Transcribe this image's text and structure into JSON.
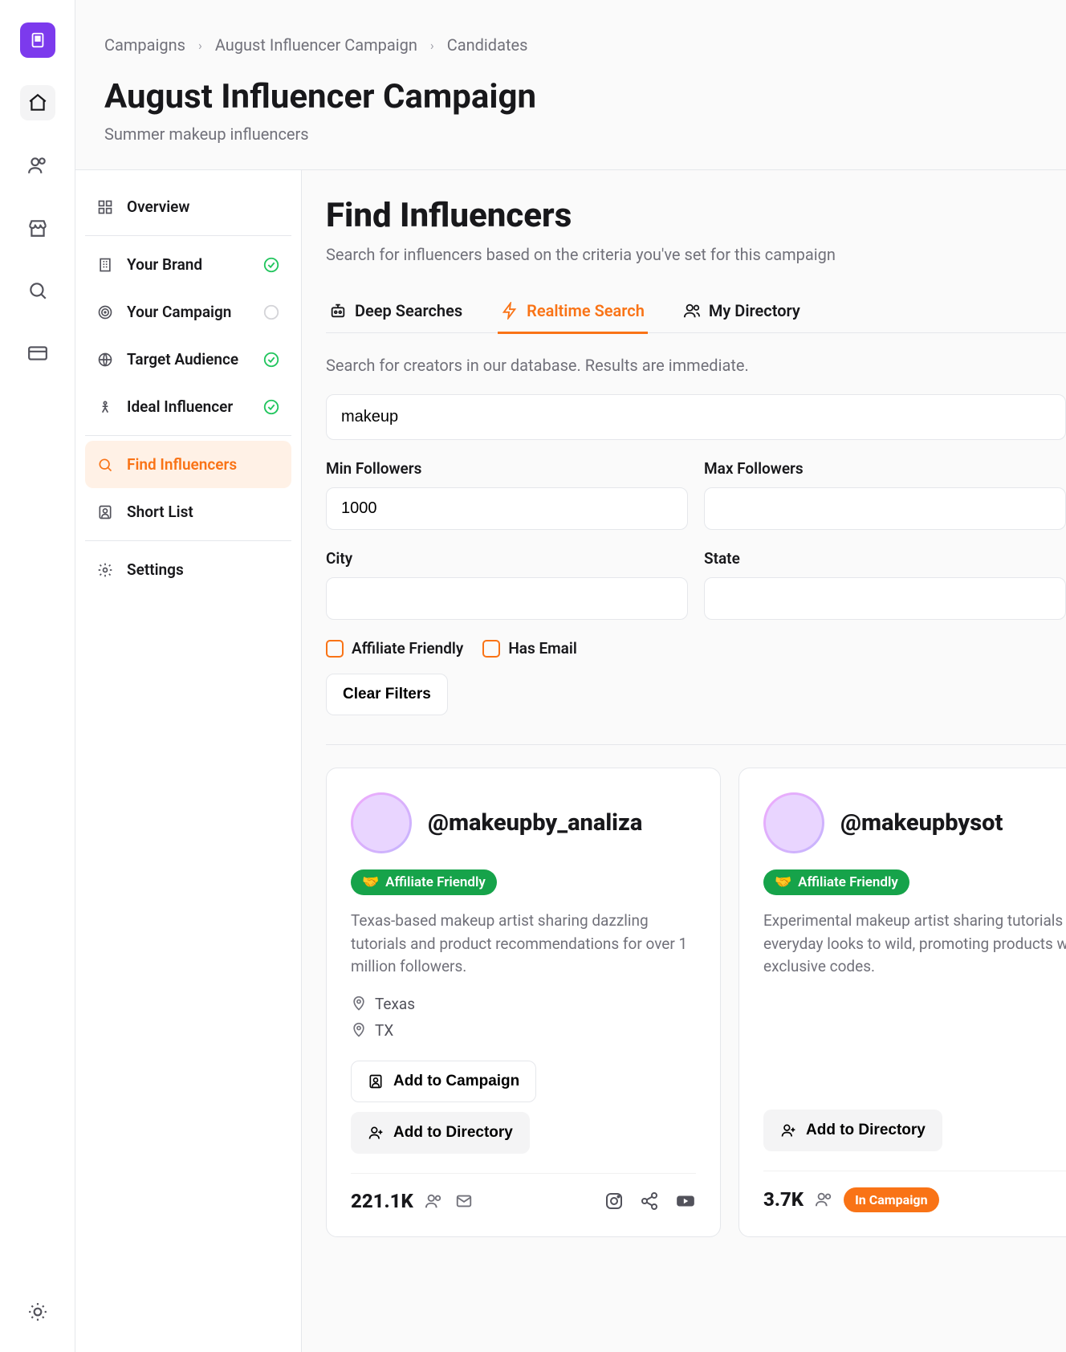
{
  "breadcrumb": [
    "Campaigns",
    "August Influencer Campaign",
    "Candidates"
  ],
  "page": {
    "title": "August Influencer Campaign",
    "subtitle": "Summer makeup influencers"
  },
  "sidebar": {
    "items": [
      {
        "label": "Overview",
        "icon": "grid",
        "status": ""
      },
      {
        "label": "Your Brand",
        "icon": "building",
        "status": "done"
      },
      {
        "label": "Your Campaign",
        "icon": "target",
        "status": "pending"
      },
      {
        "label": "Target Audience",
        "icon": "globe",
        "status": "done"
      },
      {
        "label": "Ideal Influencer",
        "icon": "person",
        "status": "done"
      },
      {
        "label": "Find Influencers",
        "icon": "search",
        "status": "active"
      },
      {
        "label": "Short List",
        "icon": "contact",
        "status": ""
      },
      {
        "label": "Settings",
        "icon": "gear",
        "status": ""
      }
    ]
  },
  "panel": {
    "title": "Find Influencers",
    "subtitle": "Search for influencers based on the criteria you've set for this campaign",
    "tabs": [
      {
        "label": "Deep Searches",
        "icon": "bot"
      },
      {
        "label": "Realtime Search",
        "icon": "zap"
      },
      {
        "label": "My Directory",
        "icon": "users"
      }
    ],
    "activeTab": 1,
    "tabDesc": "Search for creators in our database. Results are immediate.",
    "search": {
      "value": "makeup"
    },
    "filters": {
      "minFollowersLabel": "Min Followers",
      "minFollowers": "1000",
      "maxFollowersLabel": "Max Followers",
      "maxFollowers": "",
      "cityLabel": "City",
      "city": "",
      "stateLabel": "State",
      "state": "",
      "affiliateLabel": "Affiliate Friendly",
      "hasEmailLabel": "Has Email",
      "clearLabel": "Clear Filters"
    }
  },
  "results": [
    {
      "handle": "@makeupby_analiza",
      "badge": "Affiliate Friendly",
      "bio": "Texas-based makeup artist sharing dazzling tutorials and product recommendations for over 1 million followers.",
      "locations": [
        "Texas",
        "TX"
      ],
      "addCampaignLabel": "Add to Campaign",
      "addDirectoryLabel": "Add to Directory",
      "followers": "221.1K",
      "inCampaign": false
    },
    {
      "handle": "@makeupbysot",
      "badge": "Affiliate Friendly",
      "bio": "Experimental makeup artist sharing tutorials from everyday looks to wild, promoting products with exclusive codes.",
      "locations": [],
      "addDirectoryLabel": "Add to Directory",
      "followers": "3.7K",
      "inCampaign": true,
      "inCampaignLabel": "In Campaign"
    }
  ]
}
